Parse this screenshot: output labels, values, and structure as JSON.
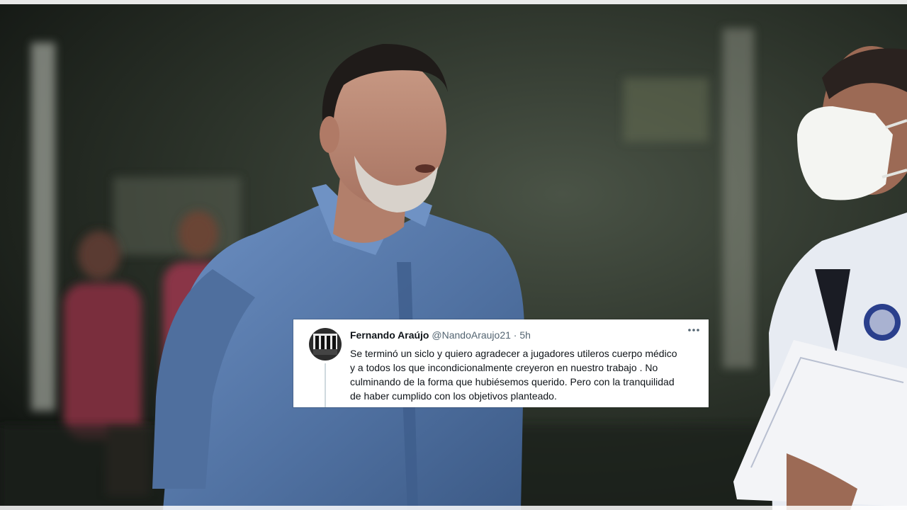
{
  "tweet": {
    "author_name": "Fernando Araújo",
    "handle": "@NandoAraujo21",
    "separator": "·",
    "time_ago": "5h",
    "more_icon": "more-dots-icon",
    "text_lines": [
      "Se terminó un siclo y quiero  agradecer a jugadores utileros cuerpo médico",
      "y a todos los que incondicionalmente creyeron en nuestro trabajo . No",
      "culminando de la forma que hubiésemos querido. Pero con la tranquilidad",
      "de haber cumplido con los objetivos planteado."
    ]
  },
  "colors": {
    "shirt_blue": "#5d7fb0",
    "background_dark": "#1c221c",
    "card_white": "#ffffff",
    "text_dark": "#0f1419",
    "text_muted": "#536471"
  }
}
